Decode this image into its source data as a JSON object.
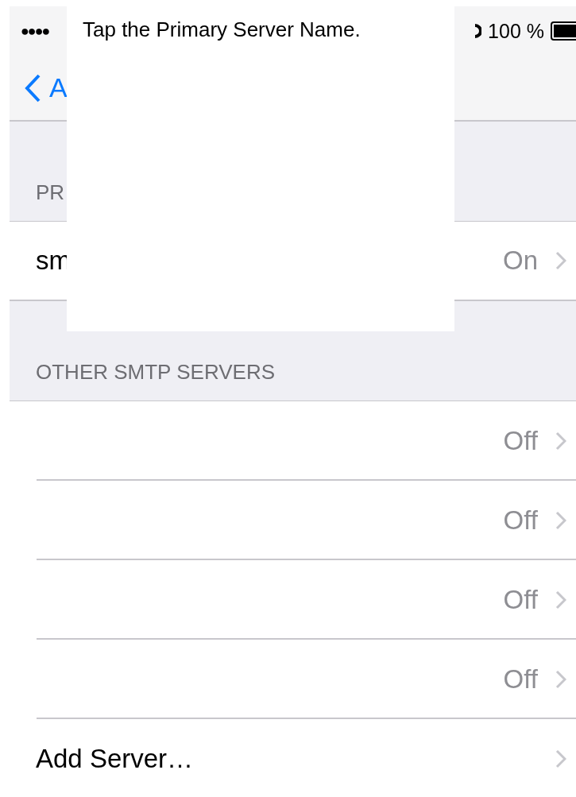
{
  "status_bar": {
    "signal_dots": "●●●●",
    "battery_text": "100 %"
  },
  "nav_bar": {
    "back_label": "A"
  },
  "sections": [
    {
      "header": "PR",
      "rows": [
        {
          "kind": "value",
          "label": "sm",
          "value": "On"
        }
      ]
    },
    {
      "header": "OTHER SMTP SERVERS",
      "rows": [
        {
          "kind": "value",
          "value": "Off"
        },
        {
          "kind": "value",
          "value": "Off"
        },
        {
          "kind": "value",
          "value": "Off"
        },
        {
          "kind": "value",
          "value": "Off"
        },
        {
          "kind": "action",
          "label": "Add Server…"
        }
      ]
    }
  ],
  "overlay": {
    "text": "Tap the Primary Server Name."
  }
}
